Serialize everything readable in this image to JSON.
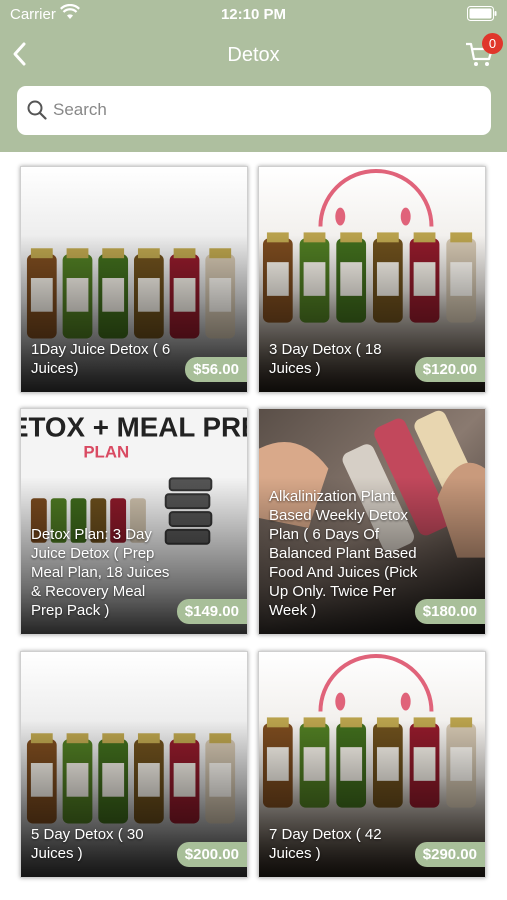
{
  "status_bar": {
    "carrier": "Carrier",
    "time": "12:10 PM"
  },
  "nav": {
    "title": "Detox",
    "cart_count": "0"
  },
  "search": {
    "placeholder": "Search"
  },
  "products": [
    {
      "title": "1Day Juice Detox ( 6 Juices)",
      "price": "$56.00"
    },
    {
      "title": "3 Day Detox ( 18 Juices )",
      "price": "$120.00"
    },
    {
      "title": "Detox Plan: 3 Day Juice Detox ( Prep Meal Plan, 18 Juices & Recovery Meal Prep Pack )",
      "price": "$149.00",
      "image_text": {
        "heading": "DETOX + MEAL PREP",
        "sub": "PLAN"
      }
    },
    {
      "title": "Alkalinization Plant Based Weekly Detox Plan ( 6 Days Of Balanced Plant Based Food And Juices (Pick Up Only. Twice Per Week )",
      "price": "$180.00"
    },
    {
      "title": "5 Day Detox ( 30 Juices )",
      "price": "$200.00"
    },
    {
      "title": "7 Day Detox ( 42 Juices )",
      "price": "$290.00"
    }
  ],
  "colors": {
    "header": "#aebf9f",
    "price_badge": "#a8bf99",
    "cart_badge": "#e0362b"
  }
}
